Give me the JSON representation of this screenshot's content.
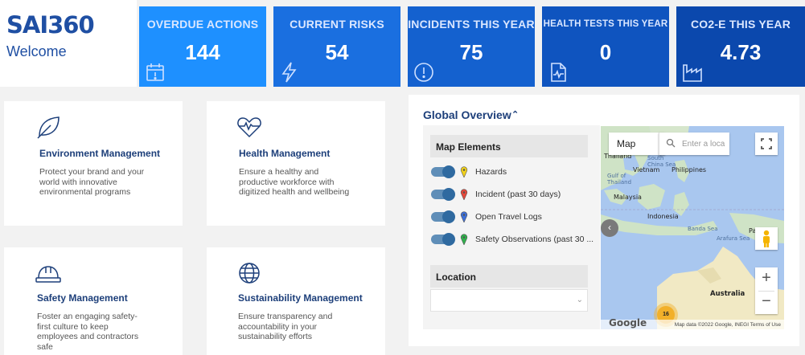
{
  "brand": {
    "logo": "SAI360",
    "welcome": "Welcome"
  },
  "kpis": [
    {
      "title": "OVERDUE ACTIONS",
      "value": "144",
      "icon": "calendar-icon"
    },
    {
      "title": "CURRENT RISKS",
      "value": "54",
      "icon": "lightning-icon"
    },
    {
      "title": "INCIDENTS THIS YEAR",
      "value": "75",
      "icon": "alert-circle-icon"
    },
    {
      "title": "HEALTH TESTS THIS YEAR",
      "value": "0",
      "icon": "health-document-icon"
    },
    {
      "title": "CO2-E THIS YEAR",
      "value": "4.73",
      "icon": "factory-icon"
    }
  ],
  "cards": [
    {
      "title": "Environment Management",
      "desc": "Protect your brand and your world with innovative environmental programs",
      "icon": "leaf-icon"
    },
    {
      "title": "Health Management",
      "desc": "Ensure a healthy and productive workforce with digitized health and wellbeing",
      "icon": "heartbeat-icon"
    },
    {
      "title": "Safety Management",
      "desc": "Foster an engaging safety-first culture to keep employees and contractors safe",
      "icon": "hard-hat-icon"
    },
    {
      "title": "Sustainability Management",
      "desc": "Ensure transparency and accountability in your sustainability efforts",
      "icon": "globe-icon"
    }
  ],
  "overview": {
    "title": "Global Overview",
    "map_elements_header": "Map Elements",
    "elements": [
      {
        "label": "Hazards",
        "color": "#f2d21b"
      },
      {
        "label": "Incident (past 30 days)",
        "color": "#e5483b"
      },
      {
        "label": "Open Travel Logs",
        "color": "#3d6fd8"
      },
      {
        "label": "Safety Observations (past 30 ...",
        "color": "#2fb24c"
      }
    ],
    "location_header": "Location",
    "location_value": ""
  },
  "map": {
    "type_button": "Map",
    "search_placeholder": "Enter a loca",
    "labels": {
      "thailand": "Thailand",
      "south_china_sea": "South China Sea",
      "vietnam": "Vietnam",
      "philippines": "Philippines",
      "gulf_of_thailand": "Gulf of Thailand",
      "malaysia": "Malaysia",
      "indonesia": "Indonesia",
      "banda_sea": "Banda Sea",
      "arafura_sea": "Arafura Sea",
      "papua": "Pa",
      "australia": "Australia"
    },
    "cluster_count": "16",
    "google": "Google",
    "attribution": "Map data ©2022 Google, INEGI   Terms of Use"
  }
}
